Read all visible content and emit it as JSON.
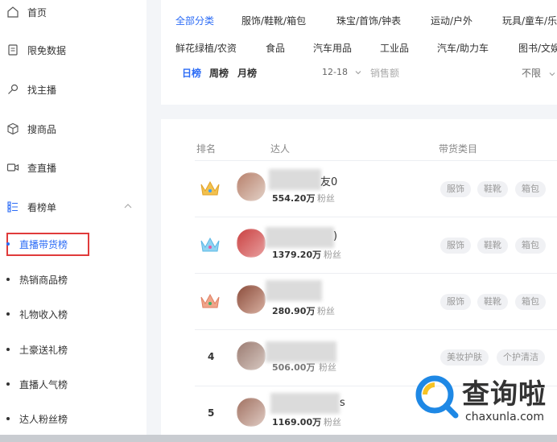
{
  "sidebar": {
    "items": [
      {
        "label": "首页",
        "icon": "home-icon"
      },
      {
        "label": "限免数据",
        "icon": "clipboard-icon"
      },
      {
        "label": "找主播",
        "icon": "key-icon"
      },
      {
        "label": "搜商品",
        "icon": "cube-icon"
      },
      {
        "label": "查直播",
        "icon": "video-icon"
      },
      {
        "label": "看榜单",
        "icon": "list-icon"
      }
    ],
    "sub_items": [
      {
        "label": "直播带货榜",
        "active": true
      },
      {
        "label": "热销商品榜"
      },
      {
        "label": "礼物收入榜"
      },
      {
        "label": "土豪送礼榜"
      },
      {
        "label": "直播人气榜"
      },
      {
        "label": "达人粉丝榜"
      }
    ]
  },
  "filters": {
    "categories_row1": [
      "全部分类",
      "服饰/鞋靴/箱包",
      "珠宝/首饰/钟表",
      "运动/户外",
      "玩具/童车/乐"
    ],
    "categories_row2": [
      "鲜花绿植/农资",
      "食品",
      "汽车用品",
      "工业品",
      "汽车/助力车",
      "图书/文娱"
    ],
    "period_tabs": [
      "日榜",
      "周榜",
      "月榜"
    ],
    "date": "12-18",
    "sales_placeholder": "销售额",
    "limit": "不限"
  },
  "table": {
    "headers": {
      "rank": "排名",
      "talent": "达人",
      "category": "带货类目"
    },
    "rows": [
      {
        "rank": "",
        "crown": "gold",
        "name_tail": "友0",
        "fans": "554.20万",
        "fans_label": "粉丝",
        "tags": [
          "服饰",
          "鞋靴",
          "箱包"
        ]
      },
      {
        "rank": "",
        "crown": "blue",
        "name_tail": ")",
        "fans": "1379.20万",
        "fans_label": "粉丝",
        "tags": [
          "服饰",
          "鞋靴",
          "箱包"
        ]
      },
      {
        "rank": "",
        "crown": "bronze",
        "name_tail": "",
        "fans": "280.90万",
        "fans_label": "粉丝",
        "tags": [
          "服饰",
          "鞋靴",
          "箱包"
        ]
      },
      {
        "rank": "4",
        "crown": "",
        "name_tail": "",
        "fans": "506.00万",
        "fans_label": "粉丝",
        "tags": [
          "美妆护肤",
          "个护清洁"
        ]
      },
      {
        "rank": "5",
        "crown": "",
        "name_tail": "s",
        "fans": "1169.00万",
        "fans_label": "粉丝",
        "tags": []
      }
    ]
  },
  "watermark": {
    "text": "查询啦",
    "domain": "chaxunla.com"
  },
  "colors": {
    "accent": "#2c6cf6",
    "highlight_border": "#e03b3b"
  }
}
